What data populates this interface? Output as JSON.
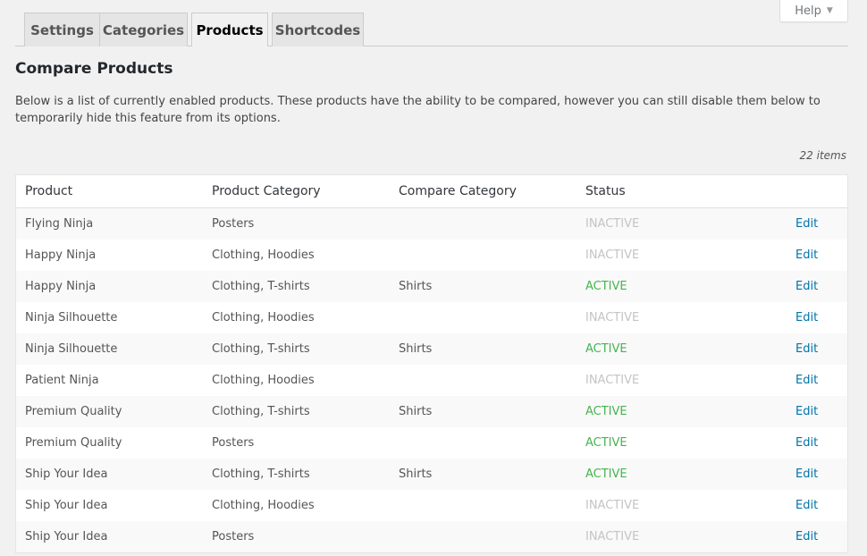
{
  "help": {
    "label": "Help"
  },
  "tabs": [
    {
      "label": "Settings"
    },
    {
      "label": "Categories"
    },
    {
      "label": "Products"
    },
    {
      "label": "Shortcodes"
    }
  ],
  "page": {
    "title": "Compare Products",
    "description": "Below is a list of currently enabled products. These products have the ability to be compared, however you can still disable them below to temporarily hide this feature from its options.",
    "items_count": "22 items"
  },
  "colors": {
    "active": "#46b450",
    "inactive": "#c3c4c7",
    "link": "#0073aa"
  },
  "table": {
    "headers": [
      "Product",
      "Product Category",
      "Compare Category",
      "Status"
    ],
    "edit_label": "Edit",
    "rows": [
      {
        "product": "Flying Ninja",
        "category": "Posters",
        "compare": "",
        "status": "INACTIVE"
      },
      {
        "product": "Happy Ninja",
        "category": "Clothing, Hoodies",
        "compare": "",
        "status": "INACTIVE"
      },
      {
        "product": "Happy Ninja",
        "category": "Clothing, T-shirts",
        "compare": "Shirts",
        "status": "ACTIVE"
      },
      {
        "product": "Ninja Silhouette",
        "category": "Clothing, Hoodies",
        "compare": "",
        "status": "INACTIVE"
      },
      {
        "product": "Ninja Silhouette",
        "category": "Clothing, T-shirts",
        "compare": "Shirts",
        "status": "ACTIVE"
      },
      {
        "product": "Patient Ninja",
        "category": "Clothing, Hoodies",
        "compare": "",
        "status": "INACTIVE"
      },
      {
        "product": "Premium Quality",
        "category": "Clothing, T-shirts",
        "compare": "Shirts",
        "status": "ACTIVE"
      },
      {
        "product": "Premium Quality",
        "category": "Posters",
        "compare": "",
        "status": "ACTIVE"
      },
      {
        "product": "Ship Your Idea",
        "category": "Clothing, T-shirts",
        "compare": "Shirts",
        "status": "ACTIVE"
      },
      {
        "product": "Ship Your Idea",
        "category": "Clothing, Hoodies",
        "compare": "",
        "status": "INACTIVE"
      },
      {
        "product": "Ship Your Idea",
        "category": "Posters",
        "compare": "",
        "status": "INACTIVE"
      }
    ]
  }
}
